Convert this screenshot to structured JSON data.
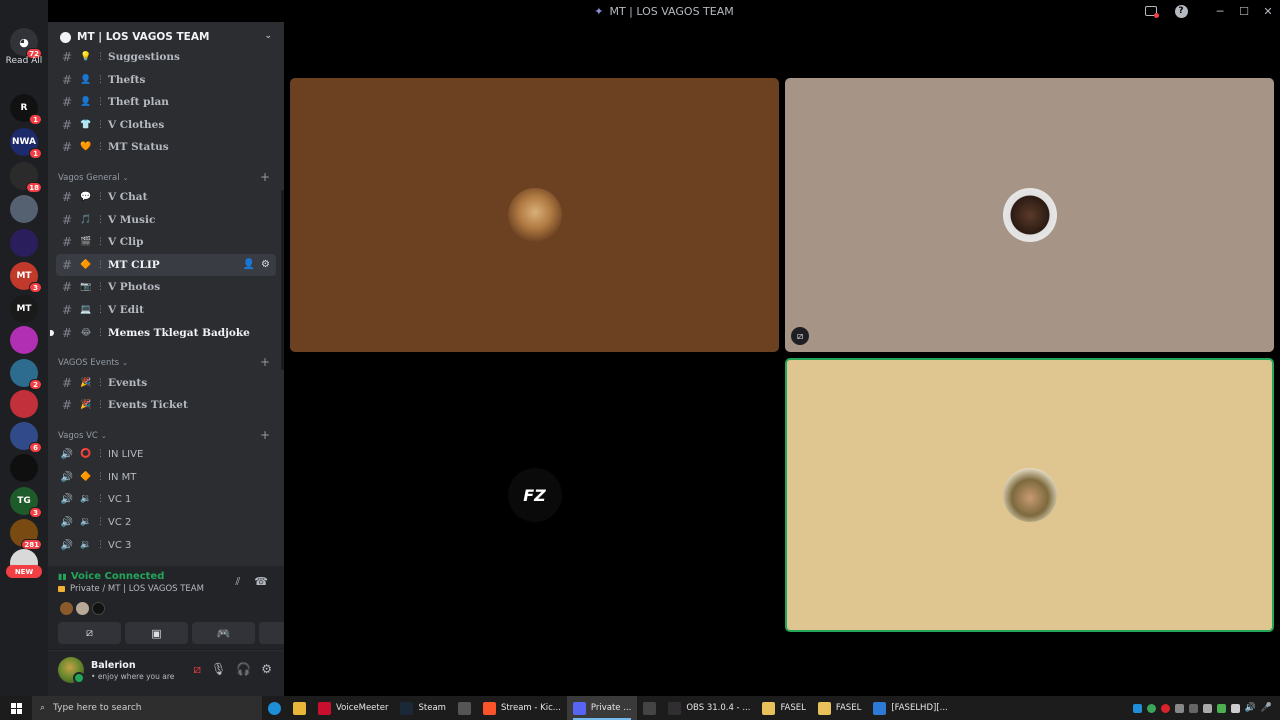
{
  "window": {
    "title": "MT | LOS VAGOS TEAM"
  },
  "rail": {
    "home_badge": "72",
    "read_all": "Read All",
    "servers": [
      {
        "label": "R",
        "color": "#111111",
        "badge": "1"
      },
      {
        "label": "NWA",
        "color": "#1d2a6b",
        "badge": "1"
      },
      {
        "label": "",
        "color": "#2b2b2b",
        "badge": "18"
      },
      {
        "label": "",
        "color": "#556070",
        "badge": ""
      },
      {
        "label": "",
        "color": "#2b1e5c",
        "badge": ""
      },
      {
        "label": "MT",
        "color": "#c0392b",
        "badge": "3"
      },
      {
        "label": "MT",
        "color": "#1a1a1a",
        "badge": ""
      },
      {
        "label": "",
        "color": "#b12fb3",
        "badge": ""
      },
      {
        "label": "",
        "color": "#2e6c8f",
        "badge": "2"
      },
      {
        "label": "",
        "color": "#c2303b",
        "badge": ""
      },
      {
        "label": "",
        "color": "#314a8a",
        "badge": "6"
      },
      {
        "label": "",
        "color": "#0f0f0f",
        "badge": ""
      },
      {
        "label": "TG",
        "color": "#1d5c2a",
        "badge": "3"
      },
      {
        "label": "",
        "color": "#7a4a13",
        "badge": "281"
      },
      {
        "label": "",
        "color": "#d9d9d9",
        "badge": ""
      }
    ],
    "new_label": "NEW"
  },
  "sidebar": {
    "guild_name": "MT | LOS VAGOS TEAM",
    "top_channels": [
      {
        "emoji": "💡",
        "name": "Suggestions"
      },
      {
        "emoji": "👤",
        "name": "Thefts"
      },
      {
        "emoji": "👤",
        "name": "Theft plan"
      },
      {
        "emoji": "👕",
        "name": "V Clothes"
      },
      {
        "emoji": "🧡",
        "name": "MT Status"
      }
    ],
    "categories": {
      "general": "Vagos General",
      "events": "VAGOS Events",
      "vc": "Vagos VC"
    },
    "general_channels": [
      {
        "emoji": "💬",
        "name": "V Chat"
      },
      {
        "emoji": "🎵",
        "name": "V Music"
      },
      {
        "emoji": "🎬",
        "name": "V Clip"
      },
      {
        "emoji": "🔶",
        "name": "MT CLIP"
      },
      {
        "emoji": "📷",
        "name": "V Photos"
      },
      {
        "emoji": "💻",
        "name": "V Edit"
      },
      {
        "emoji": "😂",
        "name": "Memes Tklegat Badjoke"
      }
    ],
    "event_channels": [
      {
        "emoji": "🎉",
        "name": "Events"
      },
      {
        "emoji": "🎉",
        "name": "Events Ticket"
      }
    ],
    "voice_channels": [
      {
        "emoji": "⭕",
        "name": "IN LIVE"
      },
      {
        "emoji": "🔶",
        "name": "IN MT"
      },
      {
        "emoji": "🔉",
        "name": "VC 1"
      },
      {
        "emoji": "🔉",
        "name": "VC 2"
      },
      {
        "emoji": "🔉",
        "name": "VC 3"
      }
    ]
  },
  "voice": {
    "status": "Voice Connected",
    "location": "Private / MT | LOS VAGOS TEAM"
  },
  "user": {
    "name": "Balerion",
    "status": "enjoy where you are"
  },
  "taskbar": {
    "search_placeholder": "Type here to search",
    "apps": [
      {
        "label": "VoiceMeeter",
        "color": "#c8102e"
      },
      {
        "label": "Steam",
        "color": "#1b2838"
      },
      {
        "label": "",
        "color": "#555555"
      },
      {
        "label": "Stream - Kic...",
        "color": "#fb542b"
      },
      {
        "label": "Private ...",
        "color": "#5865f2"
      },
      {
        "label": "",
        "color": "#444444"
      },
      {
        "label": "OBS 31.0.4 - ...",
        "color": "#302e31"
      },
      {
        "label": "FASEL",
        "color": "#e8c15b"
      },
      {
        "label": "FASEL",
        "color": "#e8c15b"
      },
      {
        "label": "[FASELHD][...",
        "color": "#2d7ad6"
      }
    ]
  },
  "colors": {
    "accent": "#5865f2",
    "voice_green": "#23a55a",
    "danger": "#f23f43"
  }
}
